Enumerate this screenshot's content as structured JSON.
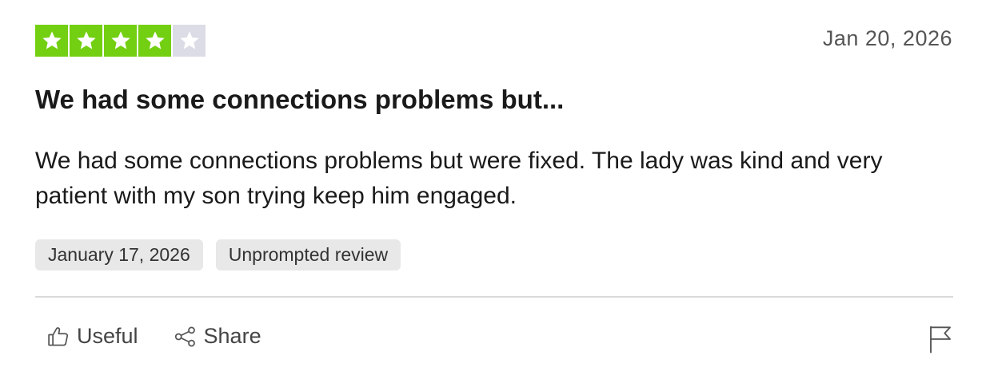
{
  "review": {
    "rating": 4,
    "max_rating": 5,
    "date": "Jan 20, 2026",
    "title": "We had some connections problems but...",
    "body": "We had some connections problems but were fixed. The lady was kind and very patient with my son trying keep him engaged.",
    "tags": [
      "January 17, 2026",
      "Unprompted review"
    ]
  },
  "actions": {
    "useful_label": "Useful",
    "share_label": "Share",
    "useful_icon": "thumbs-up-icon",
    "share_icon": "share-icon",
    "report_icon": "flag-icon"
  },
  "colors": {
    "star_filled": "#73cf11",
    "star_empty": "#dcdce6",
    "star_glyph": "#ffffff",
    "tag_bg": "#e8e8e8",
    "divider": "#d9d9d9"
  }
}
